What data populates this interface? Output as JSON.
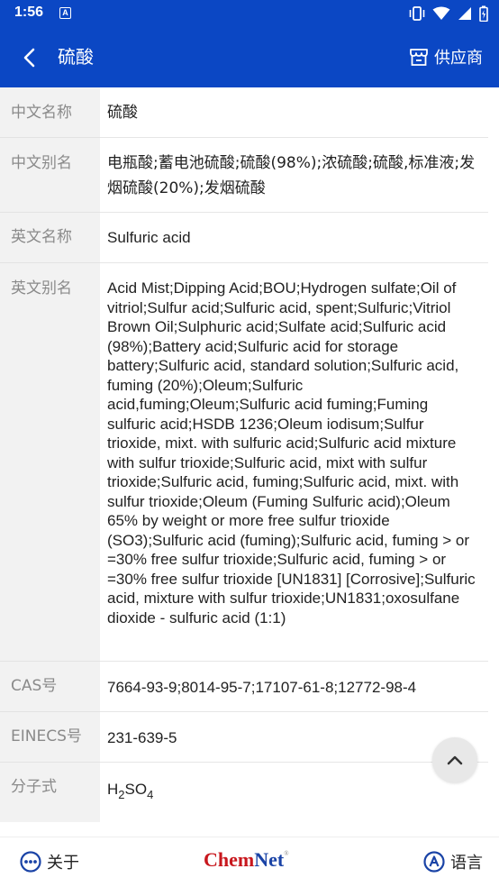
{
  "status_bar": {
    "time": "1:56",
    "notification_letter": "A",
    "icons": [
      "vibrate-icon",
      "wifi-icon",
      "signal-icon",
      "battery-icon"
    ]
  },
  "app_bar": {
    "title": "硫酸",
    "supplier_label": "供应商",
    "color": "#0b47c4"
  },
  "details": [
    {
      "label": "中文名称",
      "value": "硫酸"
    },
    {
      "label": "中文别名",
      "value": "电瓶酸;蓄电池硫酸;硫酸(98%);浓硫酸;硫酸,标准液;发烟硫酸(20%);发烟硫酸"
    },
    {
      "label": "英文名称",
      "value": "Sulfuric acid"
    },
    {
      "label": "英文别名",
      "value": "Acid Mist;Dipping Acid;BOU;Hydrogen sulfate;Oil of vitriol;Sulfur acid;Sulfuric acid, spent;Sulfuric;Vitriol Brown Oil;Sulphuric acid;Sulfate acid;Sulfuric acid (98%);Battery acid;Sulfuric acid for storage battery;Sulfuric acid, standard solution;Sulfuric acid, fuming (20%);Oleum;Sulfuric acid,fuming;Oleum;Sulfuric acid fuming;Fuming sulfuric acid;HSDB 1236;Oleum iodisum;Sulfur trioxide, mixt. with sulfuric acid;Sulfuric acid mixture with sulfur trioxide;Sulfuric acid, mixt with sulfur trioxide;Sulfuric acid, fuming;Sulfuric acid, mixt. with sulfur trioxide;Oleum (Fuming Sulfuric acid);Oleum 65% by weight or more free sulfur trioxide (SO3);Sulfuric acid (fuming);Sulfuric acid, fuming > or =30% free sulfur trioxide;Sulfuric acid, fuming > or =30% free sulfur trioxide [UN1831] [Corrosive];Sulfuric acid, mixture with sulfur trioxide;UN1831;oxosulfane dioxide - sulfuric acid (1:1)"
    },
    {
      "label": "CAS号",
      "value": "7664-93-9;8014-95-7;17107-61-8;12772-98-4"
    },
    {
      "label": "EINECS号",
      "value": "231-639-5"
    },
    {
      "label": "分子式",
      "formula": {
        "h": "H",
        "h_sub": "2",
        "so": "SO",
        "o_sub": "4"
      }
    }
  ],
  "bottom_bar": {
    "about_label": "关于",
    "brand_chem": "Chem",
    "brand_net": "Net",
    "brand_reg": "®",
    "language_label": "语言"
  },
  "colors": {
    "brand_red": "#c8171d",
    "brand_blue": "#1a43a6",
    "icon_blue": "#1a43a6"
  }
}
